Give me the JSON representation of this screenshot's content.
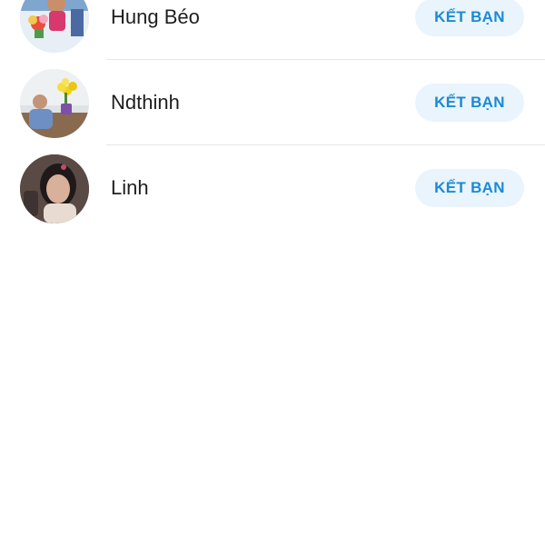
{
  "suggestions": [
    {
      "name": "Hung Béo",
      "action_label": "KẾT BẠN",
      "avatar": "person-photo-with-flowers"
    },
    {
      "name": "Ndthinh",
      "action_label": "KẾT BẠN",
      "avatar": "person-photo-with-yellow-flowers"
    },
    {
      "name": "Linh",
      "action_label": "KẾT BẠN",
      "avatar": "person-photo-portrait"
    }
  ],
  "colors": {
    "accent": "#1a8ad6",
    "button_bg": "#e9f4fc",
    "divider": "#e4e6e9",
    "text": "#1e1e1e"
  }
}
